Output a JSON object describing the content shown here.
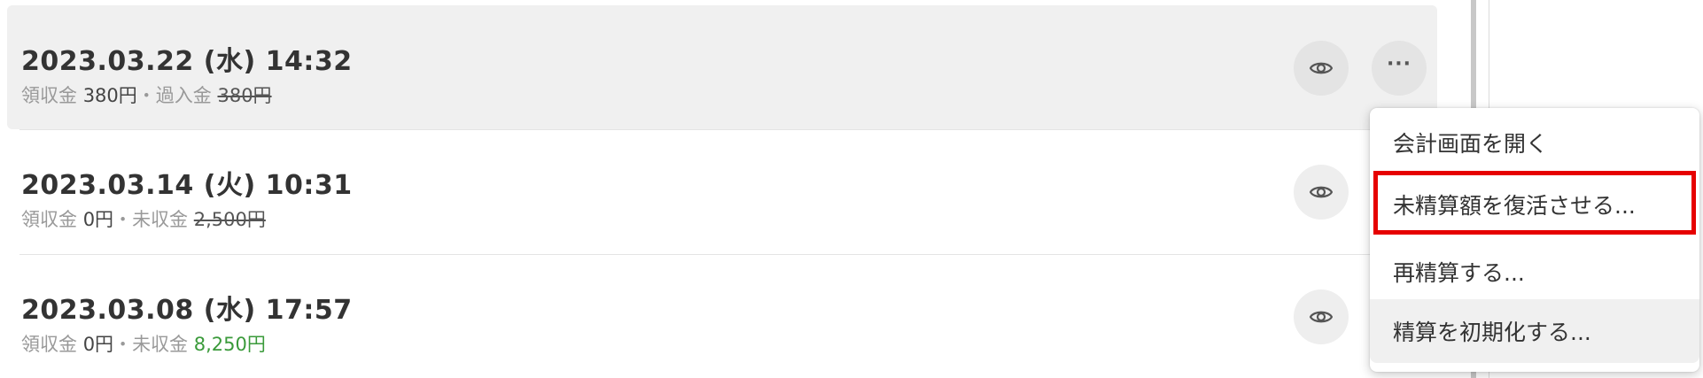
{
  "rows": [
    {
      "datetime": "2023.03.22 (水) 14:32",
      "received_label": "領収金",
      "received_value": "380円",
      "sep": "・",
      "status_label": "過入金",
      "status_value": "380円"
    },
    {
      "datetime": "2023.03.14 (火) 10:31",
      "received_label": "領収金",
      "received_value": "0円",
      "sep": "・",
      "status_label": "未収金",
      "status_value": "2,500円"
    },
    {
      "datetime": "2023.03.08 (水) 17:57",
      "received_label": "領収金",
      "received_value": "0円",
      "sep": "・",
      "status_label": "未収金",
      "status_value": "8,250円"
    }
  ],
  "more_button_glyph": "···",
  "menu": {
    "items": [
      {
        "label": "会計画面を開く"
      },
      {
        "label": "未精算額を復活させる..."
      },
      {
        "label": "再精算する..."
      },
      {
        "label": "精算を初期化する..."
      }
    ]
  },
  "colors": {
    "highlight_border": "#e60000",
    "positive_amount": "#3a9a3a"
  }
}
